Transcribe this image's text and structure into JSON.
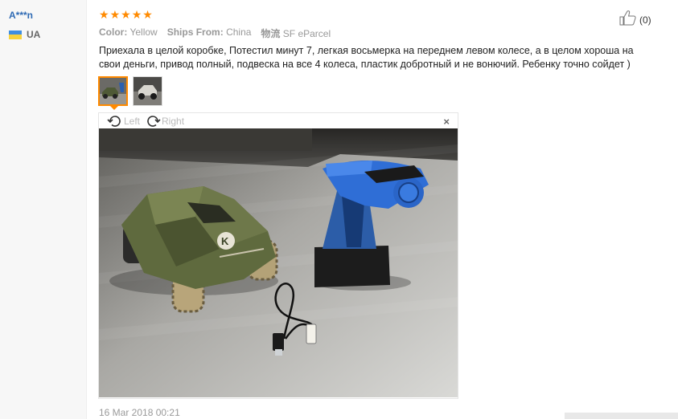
{
  "reviewer": {
    "name": "A***n",
    "country_code": "UA",
    "flag_colors": {
      "top": "#3f8ee0",
      "bottom": "#f7d23c"
    }
  },
  "rating": {
    "stars": 5,
    "star_glyph": "★",
    "color": "#ff8a00"
  },
  "meta": {
    "color_label": "Color:",
    "color_value": "Yellow",
    "ships_label": "Ships From:",
    "ships_value": "China",
    "logistics_label": "物流",
    "logistics_value": "SF eParcel"
  },
  "like": {
    "icon": "thumbs-up-icon",
    "count": "(0)"
  },
  "review_text": "Приехала в целой коробке, Потестил минут 7, легкая восьмерка на переднем левом колесе, а в целом хороша на свои деньги, привод полный, подвеска на все 4 колеса, пластик добротный и не вонючий. Ребенку точно сойдет )",
  "thumbnails": [
    {
      "name": "photo-1",
      "active": true
    },
    {
      "name": "photo-2",
      "active": false
    }
  ],
  "viewer": {
    "rotate_left_label": "Left",
    "rotate_right_label": "Right",
    "close_glyph": "×"
  },
  "date": "16 Mar 2018 00:21"
}
